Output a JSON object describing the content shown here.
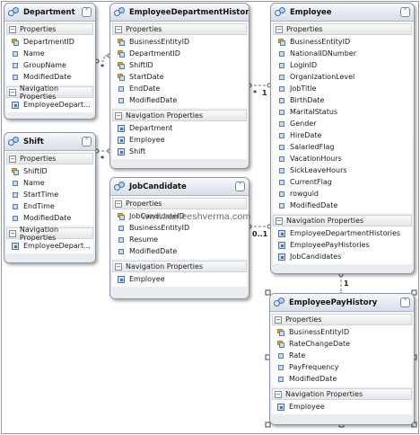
{
  "watermark": "www.raineeshverma.com",
  "section_labels": {
    "properties": "Properties",
    "navigation": "Navigation Properties"
  },
  "entities": {
    "department": {
      "title": "Department",
      "properties": [
        {
          "name": "DepartmentID",
          "key": true
        },
        {
          "name": "Name",
          "key": false
        },
        {
          "name": "GroupName",
          "key": false
        },
        {
          "name": "ModifiedDate",
          "key": false
        }
      ],
      "navigation": [
        "EmployeeDepart..."
      ]
    },
    "shift": {
      "title": "Shift",
      "properties": [
        {
          "name": "ShiftID",
          "key": true
        },
        {
          "name": "Name",
          "key": false
        },
        {
          "name": "StartTime",
          "key": false
        },
        {
          "name": "EndTime",
          "key": false
        },
        {
          "name": "ModifiedDate",
          "key": false
        }
      ],
      "navigation": [
        "EmployeeDepart..."
      ]
    },
    "edh": {
      "title": "EmployeeDepartmentHistory",
      "properties": [
        {
          "name": "BusinessEntityID",
          "key": true
        },
        {
          "name": "DepartmentID",
          "key": true
        },
        {
          "name": "ShiftID",
          "key": true
        },
        {
          "name": "StartDate",
          "key": true
        },
        {
          "name": "EndDate",
          "key": false
        },
        {
          "name": "ModifiedDate",
          "key": false
        }
      ],
      "navigation": [
        "Department",
        "Employee",
        "Shift"
      ]
    },
    "jobcandidate": {
      "title": "JobCandidate",
      "properties": [
        {
          "name": "JobCandidateID",
          "key": true
        },
        {
          "name": "BusinessEntityID",
          "key": false
        },
        {
          "name": "Resume",
          "key": false
        },
        {
          "name": "ModifiedDate",
          "key": false
        }
      ],
      "navigation": [
        "Employee"
      ]
    },
    "employee": {
      "title": "Employee",
      "properties": [
        {
          "name": "BusinessEntityID",
          "key": true
        },
        {
          "name": "NationalIDNumber",
          "key": false
        },
        {
          "name": "LoginID",
          "key": false
        },
        {
          "name": "OrganizationLevel",
          "key": false
        },
        {
          "name": "JobTitle",
          "key": false
        },
        {
          "name": "BirthDate",
          "key": false
        },
        {
          "name": "MaritalStatus",
          "key": false
        },
        {
          "name": "Gender",
          "key": false
        },
        {
          "name": "HireDate",
          "key": false
        },
        {
          "name": "SalariedFlag",
          "key": false
        },
        {
          "name": "VacationHours",
          "key": false
        },
        {
          "name": "SickLeaveHours",
          "key": false
        },
        {
          "name": "CurrentFlag",
          "key": false
        },
        {
          "name": "rowguid",
          "key": false
        },
        {
          "name": "ModifiedDate",
          "key": false
        }
      ],
      "navigation": [
        "EmployeeDepartmentHistories",
        "EmployeePayHistories",
        "JobCandidates"
      ]
    },
    "payhistory": {
      "title": "EmployeePayHistory",
      "properties": [
        {
          "name": "BusinessEntityID",
          "key": true
        },
        {
          "name": "RateChangeDate",
          "key": true
        },
        {
          "name": "Rate",
          "key": false
        },
        {
          "name": "PayFrequency",
          "key": false
        },
        {
          "name": "ModifiedDate",
          "key": false
        }
      ],
      "navigation": [
        "Employee"
      ]
    }
  },
  "multiplicities": {
    "dept_edh": "*",
    "shift_edh": "*",
    "edh_emp_many": "*",
    "edh_emp_one": "1",
    "jc_emp": "0..1",
    "emp_pay": "1"
  }
}
